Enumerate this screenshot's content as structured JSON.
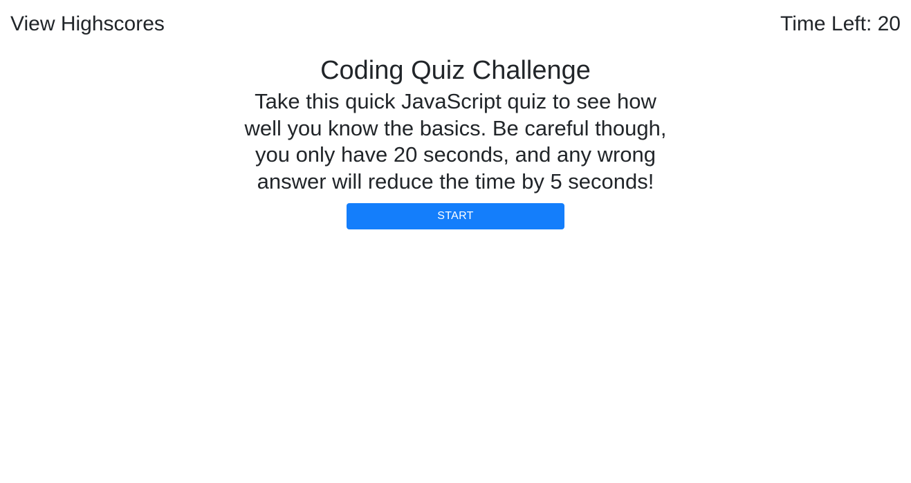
{
  "header": {
    "highscores_label": "View Highscores",
    "timer_label": "Time Left: 20"
  },
  "main": {
    "title": "Coding Quiz Challenge",
    "intro": "Take this quick JavaScript quiz to see how well you know the basics. Be careful though, you only have 20 seconds, and any wrong answer will reduce the time by 5 seconds!",
    "start_label": "START"
  },
  "colors": {
    "button_background": "#147efb",
    "button_text": "#ffffff",
    "text": "#212529",
    "background": "#ffffff"
  }
}
